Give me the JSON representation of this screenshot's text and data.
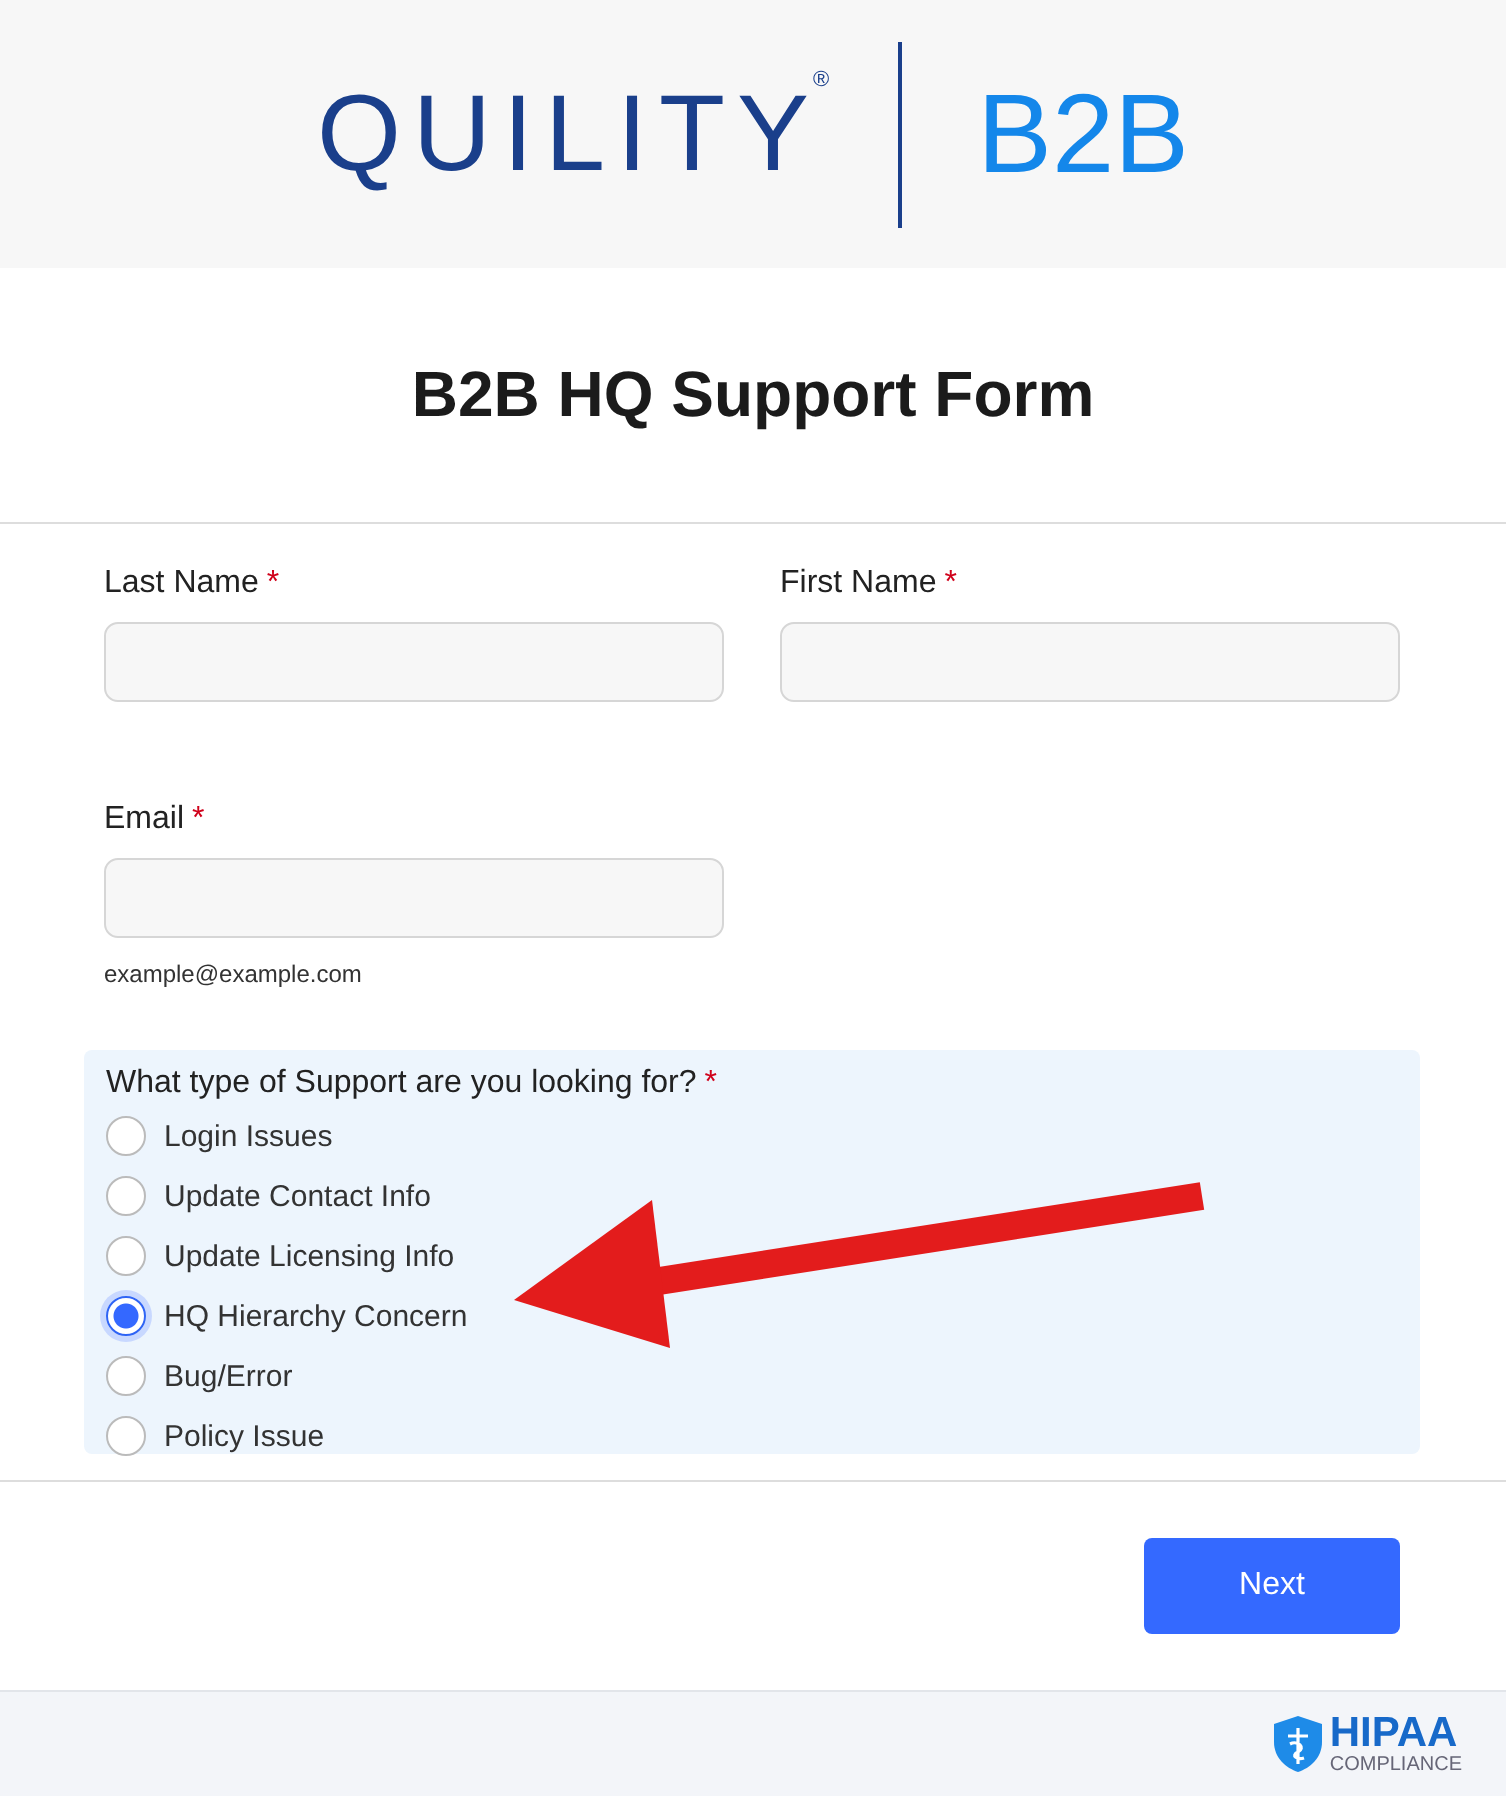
{
  "header": {
    "brand": "QUILITY",
    "registered": "®",
    "product": "B2B"
  },
  "form": {
    "title": "B2B HQ Support Form",
    "fields": [
      {
        "label": "Last Name",
        "required_mark": "*"
      },
      {
        "label": "First Name",
        "required_mark": "*"
      },
      {
        "label": "Email",
        "required_mark": "*",
        "hint": "example@example.com"
      }
    ],
    "support": {
      "question": "What type of Support are you looking for?",
      "required_mark": "*",
      "options": [
        {
          "label": "Login Issues",
          "selected": false
        },
        {
          "label": "Update Contact Info",
          "selected": false
        },
        {
          "label": "Update Licensing Info",
          "selected": false
        },
        {
          "label": "HQ Hierarchy Concern",
          "selected": true
        },
        {
          "label": "Bug/Error",
          "selected": false
        },
        {
          "label": "Policy Issue",
          "selected": false
        }
      ]
    },
    "next_button": "Next"
  },
  "footer": {
    "badge_title": "HIPAA",
    "badge_subtitle": "COMPLIANCE"
  }
}
